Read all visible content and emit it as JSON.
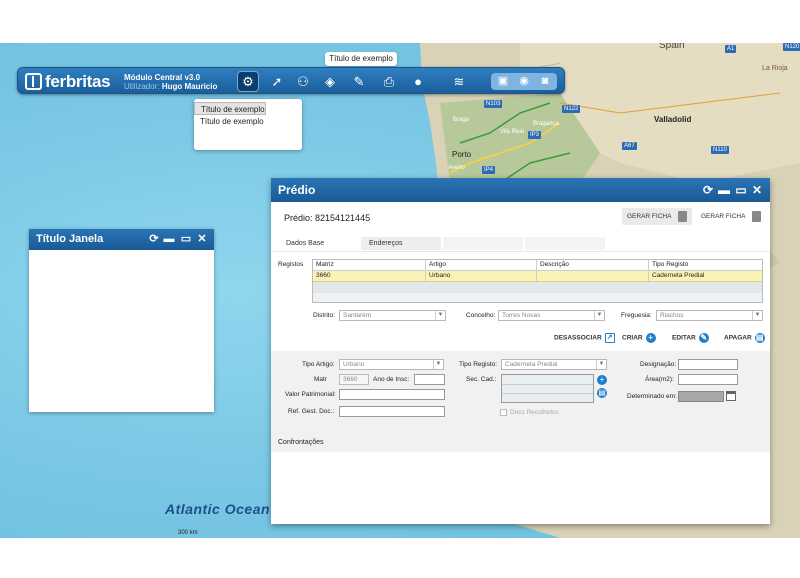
{
  "map": {
    "ocean_label": "Atlantic Ocean",
    "scale_label": "300 km",
    "places": [
      "Spain",
      "Valladolid",
      "Braga",
      "Porto",
      "Aveiro",
      "Vila Real",
      "Bragança",
      "La Rioja"
    ],
    "roads": [
      "A1",
      "N103",
      "N122",
      "IP3",
      "A67",
      "N110",
      "N120",
      "IP4"
    ]
  },
  "toolbar": {
    "brand": "ferbritas",
    "module": "Módulo Central v3.0",
    "user_label": "Utilizador:",
    "user_name": "Hugo Mauricio",
    "tooltip": "Título de exemplo",
    "menu_items": [
      "Título de exemplo",
      "Título de exemplo",
      "Título de exemplo"
    ],
    "icons": [
      "tools-icon",
      "cursor-info-icon",
      "people-icon",
      "layers-stack-icon",
      "satellite-icon",
      "print-icon",
      "globe-icon",
      "layers-icon",
      "screen-icon",
      "world-icon",
      "camera-icon"
    ]
  },
  "small_window": {
    "title": "Título Janela",
    "controls": [
      "refresh",
      "minimize",
      "maximize",
      "close"
    ]
  },
  "predio": {
    "title": "Prédio",
    "subtitle": "Prédio: 82154121445",
    "gerar_ficha_1": "GERAR FICHA",
    "gerar_ficha_2": "GERAR FICHA",
    "tabs": [
      "Dados Base",
      "Endereços",
      "",
      ""
    ],
    "registos_label": "Registos",
    "table": {
      "headers": [
        "Matriz",
        "Artigo",
        "Descrição",
        "Tipo Registo"
      ],
      "rows": [
        [
          "3660",
          "Urbano",
          "",
          "Caderneta Predial"
        ]
      ]
    },
    "distrito_label": "Distrito:",
    "distrito_value": "Santarém",
    "concelho_label": "Concelho:",
    "concelho_value": "Torres Novas",
    "freguesia_label": "Freguesia:",
    "freguesia_value": "Riachos",
    "actions": [
      "DESASSOCIAR",
      "CRIAR",
      "EDITAR",
      "APAGAR"
    ],
    "tipo_artigo_label": "Tipo Artigo:",
    "tipo_artigo_value": "Urbano",
    "matr_label": "Matr",
    "matr_value": "3660",
    "ano_label": "Ano de Insc:",
    "ano_value": "",
    "valor_label": "Valor Patrimonial:",
    "refgest_label": "Ref. Gest. Doc.:",
    "tipo_registo_label": "Tipo Registo:",
    "tipo_registo_value": "Caderneta Predial",
    "seccad_label": "Sec. Cad.:",
    "docs_label": "Docs Recolhidos",
    "designacao_label": "Designação:",
    "area_label": "Área(m2):",
    "determinado_label": "Determinado em:",
    "confrontacoes_label": "Confrontações"
  }
}
